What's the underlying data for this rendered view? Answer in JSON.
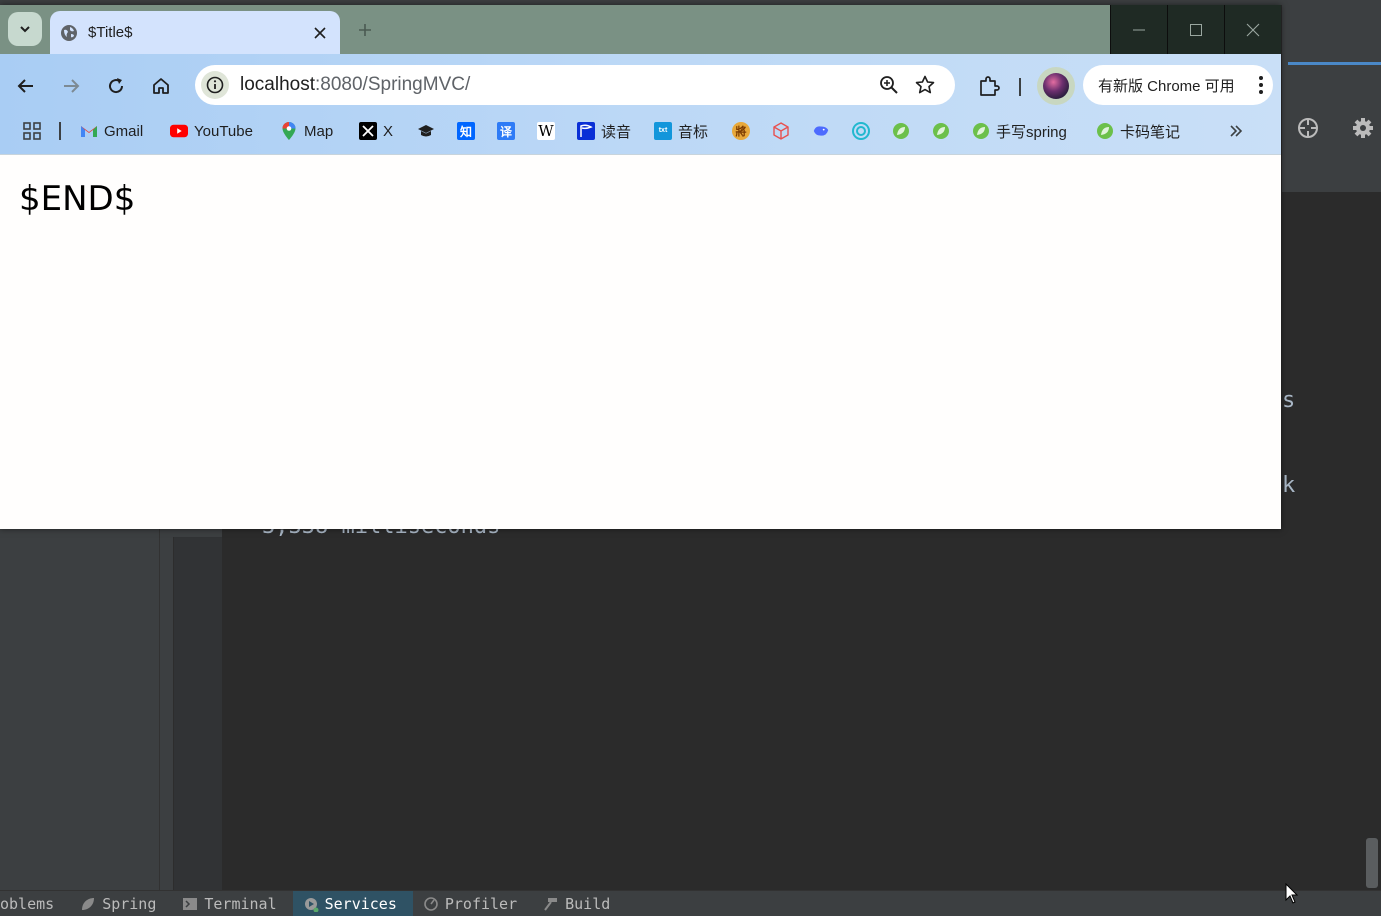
{
  "ide": {
    "console_text": "3,338 milliseconds",
    "edge_char_1": "s",
    "edge_char_2": "k",
    "toolwindows": [
      {
        "label": "oblems",
        "icon": "problems-icon"
      },
      {
        "label": "Spring",
        "icon": "spring-leaf-icon"
      },
      {
        "label": "Terminal",
        "icon": "terminal-icon"
      },
      {
        "label": "Services",
        "icon": "services-icon",
        "active": true
      },
      {
        "label": "Profiler",
        "icon": "profiler-icon"
      },
      {
        "label": "Build",
        "icon": "hammer-icon"
      }
    ]
  },
  "browser": {
    "tab_title": "$Title$",
    "url_host": "localhost",
    "url_path": ":8080/SpringMVC/",
    "update_label": "有新版 Chrome 可用",
    "bookmarks": [
      {
        "label": "Gmail",
        "icon": "gmail-icon"
      },
      {
        "label": "YouTube",
        "icon": "youtube-icon"
      },
      {
        "label": "Map",
        "icon": "maps-pin-icon"
      },
      {
        "label": "X",
        "icon": "x-logo-icon"
      },
      {
        "label": "",
        "icon": "graduation-cap-icon"
      },
      {
        "label": "",
        "icon": "zhihu-icon",
        "glyph": "知"
      },
      {
        "label": "",
        "icon": "translate-icon",
        "glyph": "译"
      },
      {
        "label": "",
        "icon": "wikipedia-icon",
        "glyph": "W"
      },
      {
        "label": "读音",
        "icon": "flag-icon"
      },
      {
        "label": "音标",
        "icon": "text-icon"
      },
      {
        "label": "",
        "icon": "chinese-chess-icon",
        "glyph": "將"
      },
      {
        "label": "",
        "icon": "cube-icon"
      },
      {
        "label": "",
        "icon": "whale-icon"
      },
      {
        "label": "",
        "icon": "swirl-icon"
      },
      {
        "label": "",
        "icon": "leaf-icon"
      },
      {
        "label": "",
        "icon": "leaf-icon"
      },
      {
        "label": "手写spring",
        "icon": "leaf-icon"
      },
      {
        "label": "卡码笔记",
        "icon": "leaf-icon"
      }
    ]
  },
  "page": {
    "body_text": "$END$"
  },
  "colors": {
    "ide_bg": "#2b2b2b",
    "ide_panel": "#3c3f41",
    "tabstrip": "#7a9184",
    "active_tab": "#d3e3fd",
    "toolbar": "#bcd8f6"
  }
}
